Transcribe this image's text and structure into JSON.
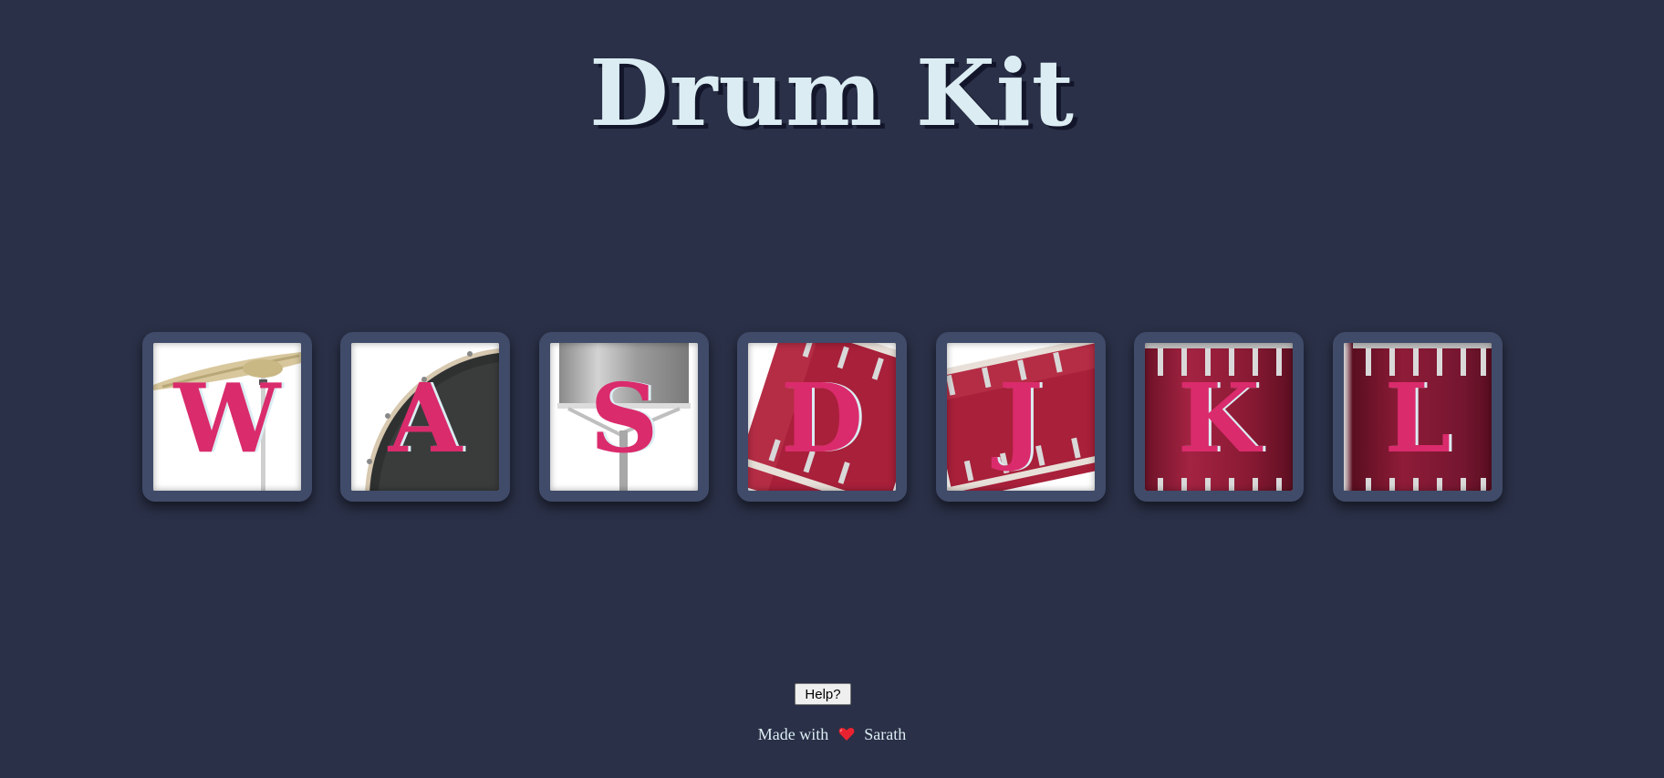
{
  "header": {
    "title": "Drum Kit"
  },
  "drums": [
    {
      "key": "W",
      "instrument": "crash"
    },
    {
      "key": "A",
      "instrument": "kick-bass"
    },
    {
      "key": "S",
      "instrument": "snare"
    },
    {
      "key": "D",
      "instrument": "tom-1"
    },
    {
      "key": "J",
      "instrument": "tom-2"
    },
    {
      "key": "K",
      "instrument": "tom-3"
    },
    {
      "key": "L",
      "instrument": "tom-4"
    }
  ],
  "help": {
    "label": "Help?"
  },
  "footer": {
    "made_with": "Made with",
    "heart_icon": "heart-icon",
    "author": "Sarath"
  },
  "colors": {
    "background": "#2a3047",
    "title": "#dbedf3",
    "drum_border": "#404b69",
    "key_letter": "#da2b6c"
  }
}
